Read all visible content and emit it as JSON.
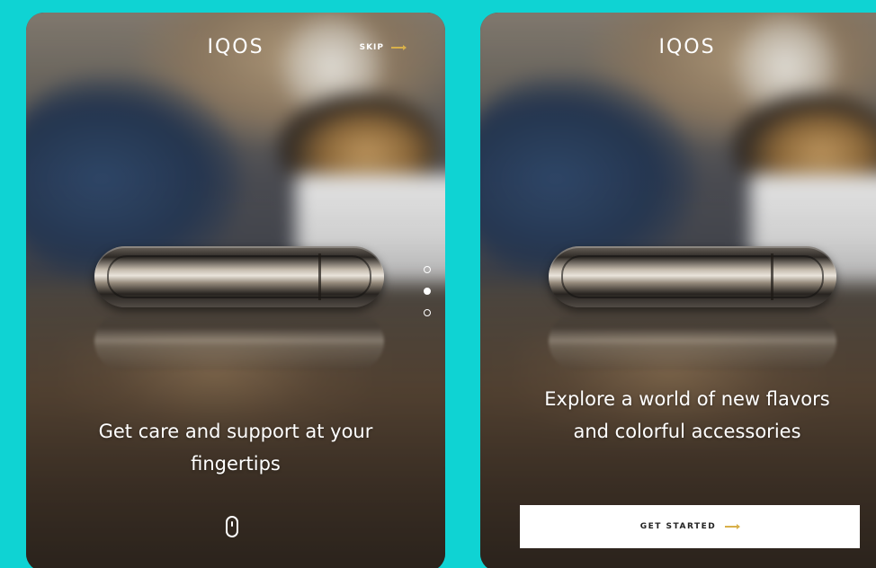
{
  "colors": {
    "background": "#0fd3d3",
    "accent": "#d8b04a",
    "button_bg": "#ffffff",
    "button_text": "#222222",
    "text": "#ffffff"
  },
  "screens": [
    {
      "logo": "IQOS",
      "skip_label": "SKIP",
      "headline": "Get care and support at your fingertips",
      "pagination": {
        "total": 3,
        "active_index": 1
      },
      "scroll_hint_icon": "mouse-scroll-icon"
    },
    {
      "logo": "IQOS",
      "headline": "Explore a world of new flavors and colorful accessories",
      "cta_label": "GET STARTED",
      "cta_icon": "arrow-right-icon"
    }
  ]
}
